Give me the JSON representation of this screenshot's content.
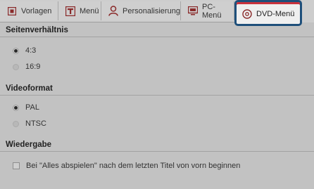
{
  "colors": {
    "background": "#c2c2c2",
    "active_tab_border": "#1e4f7a",
    "active_tab_accent": "#c8323c"
  },
  "tabs": [
    {
      "label": "Vorlagen",
      "icon": "templates-icon"
    },
    {
      "label": "Menü",
      "icon": "menu-icon"
    },
    {
      "label": "Personalisierung",
      "icon": "person-icon"
    },
    {
      "label": "PC-Menü",
      "icon": "monitor-icon"
    },
    {
      "label": "DVD-Menü",
      "icon": "dvd-icon",
      "active": true
    }
  ],
  "aspect": {
    "title": "Seitenverhältnis",
    "options": [
      {
        "label": "4:3",
        "selected": true
      },
      {
        "label": "16:9",
        "selected": false
      }
    ]
  },
  "video": {
    "title": "Videoformat",
    "options": [
      {
        "label": "PAL",
        "selected": true
      },
      {
        "label": "NTSC",
        "selected": false
      }
    ]
  },
  "playback": {
    "title": "Wiedergabe",
    "checkbox_label": "Bei \"Alles abspielen\" nach dem letzten Titel von vorn beginnen",
    "checked": false
  }
}
